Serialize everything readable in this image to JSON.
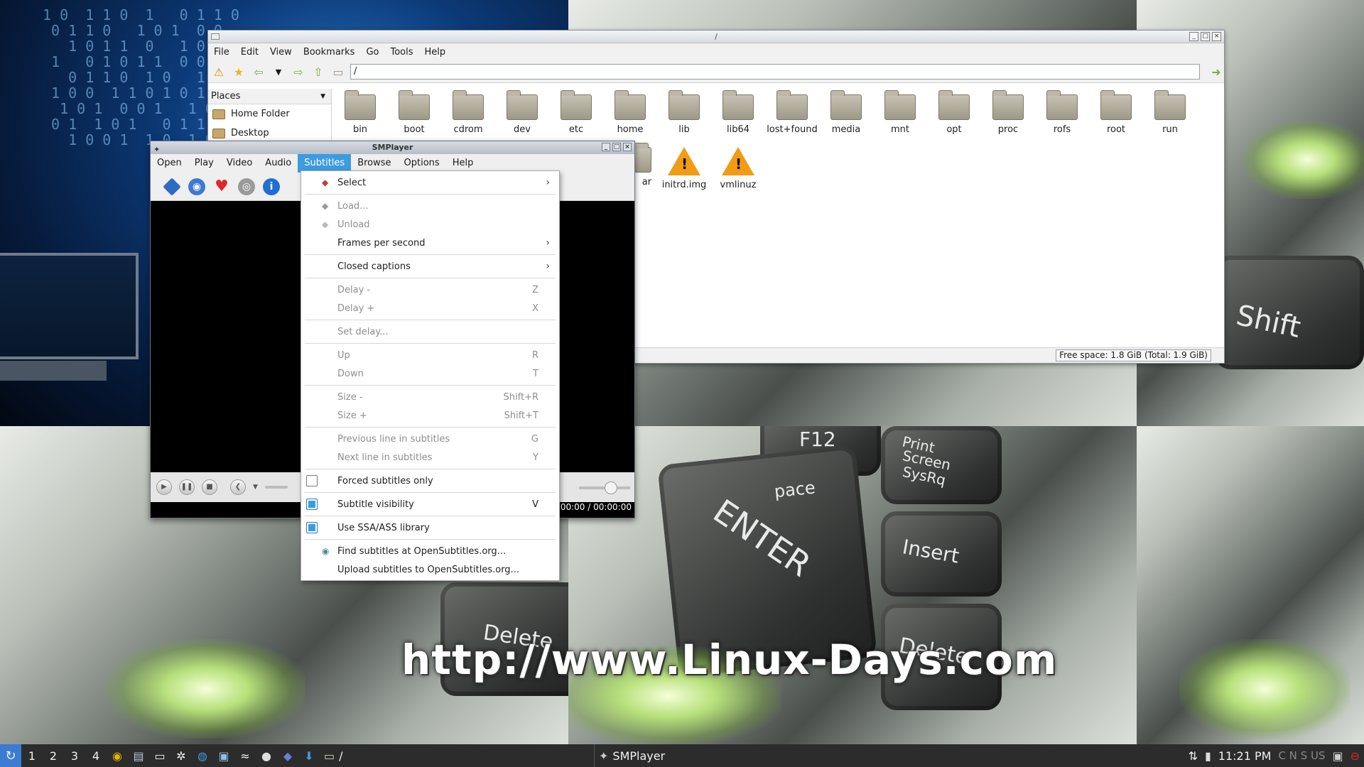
{
  "wallpaper": {
    "url_text": "http://www.Linux-Days.com",
    "key_labels": [
      "F12",
      "Print Screen SysRq",
      "Insert",
      "Delete",
      "Shift",
      "ENTER",
      "Delete",
      "Print",
      "Screen",
      "SysRq",
      "pace"
    ]
  },
  "file_manager": {
    "title": "/",
    "menu": [
      "File",
      "Edit",
      "View",
      "Bookmarks",
      "Go",
      "Tools",
      "Help"
    ],
    "path": "/",
    "places_label": "Places",
    "places": [
      "Home Folder",
      "Desktop"
    ],
    "files_row1": [
      "bin",
      "boot",
      "cdrom",
      "dev",
      "etc",
      "home",
      "lib",
      "lib64",
      "lost+found",
      "media",
      "mnt",
      "opt",
      "proc",
      "rofs",
      "root",
      "run"
    ],
    "files_row2_partial": "ar",
    "files_row2": [
      "initrd.img",
      "vmlinuz"
    ],
    "free_space": "Free space: 1.8 GiB (Total: 1.9 GiB)"
  },
  "smplayer": {
    "title": "SMPlayer",
    "menu": [
      "Open",
      "Play",
      "Video",
      "Audio",
      "Subtitles",
      "Browse",
      "Options",
      "Help"
    ],
    "time": "00:00 / 00:00:00"
  },
  "subtitles_menu": {
    "select": "Select",
    "load": "Load...",
    "unload": "Unload",
    "fps": "Frames per second",
    "closed_captions": "Closed captions",
    "delay_minus": "Delay -",
    "delay_minus_sc": "Z",
    "delay_plus": "Delay +",
    "delay_plus_sc": "X",
    "set_delay": "Set delay...",
    "up": "Up",
    "up_sc": "R",
    "down": "Down",
    "down_sc": "T",
    "size_minus": "Size -",
    "size_minus_sc": "Shift+R",
    "size_plus": "Size +",
    "size_plus_sc": "Shift+T",
    "prev_line": "Previous line in subtitles",
    "prev_line_sc": "G",
    "next_line": "Next line in subtitles",
    "next_line_sc": "Y",
    "forced_only": "Forced subtitles only",
    "forced_only_checked": false,
    "visibility": "Subtitle visibility",
    "visibility_sc": "V",
    "visibility_checked": true,
    "use_ssa": "Use SSA/ASS library",
    "use_ssa_checked": true,
    "find_subs": "Find subtitles at OpenSubtitles.org...",
    "upload_subs": "Upload subtitles to OpenSubtitles.org..."
  },
  "taskbar": {
    "workspaces": [
      "1",
      "2",
      "3",
      "4"
    ],
    "path_task": "/",
    "active_task": "SMPlayer",
    "clock": "11:21 PM",
    "indicators": "C N S US"
  },
  "colors": {
    "accent": "#3d9be0",
    "taskbar": "#2c2c2c",
    "folder": "#b8b2a2",
    "warning": "#f29b15"
  }
}
